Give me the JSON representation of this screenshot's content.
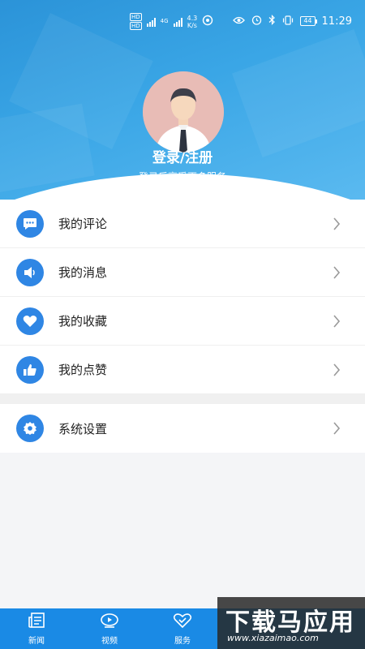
{
  "status_bar": {
    "net1": "HD",
    "net2": "HD",
    "net3": "4G",
    "speed_value": "4.3",
    "speed_unit": "K/s",
    "battery": "44",
    "time": "11:29"
  },
  "profile": {
    "login_title": "登录/注册",
    "login_subtitle": "登录后享受更多服务"
  },
  "menu": [
    {
      "label": "我的评论",
      "icon": "comment-icon"
    },
    {
      "label": "我的消息",
      "icon": "speaker-icon"
    },
    {
      "label": "我的收藏",
      "icon": "heart-icon"
    },
    {
      "label": "我的点赞",
      "icon": "thumbs-up-icon"
    }
  ],
  "settings": {
    "label": "系统设置",
    "icon": "gear-icon"
  },
  "bottom_nav": [
    {
      "label": "新闻",
      "icon": "news-icon"
    },
    {
      "label": "视频",
      "icon": "video-icon"
    },
    {
      "label": "服务",
      "icon": "service-icon"
    }
  ],
  "watermark": {
    "main": "下载马应用",
    "sub": "www.xiazaimao.com"
  },
  "colors": {
    "header_blue": "#2b93d8",
    "icon_blue": "#2f86e4",
    "nav_blue": "#1a8ae5"
  }
}
